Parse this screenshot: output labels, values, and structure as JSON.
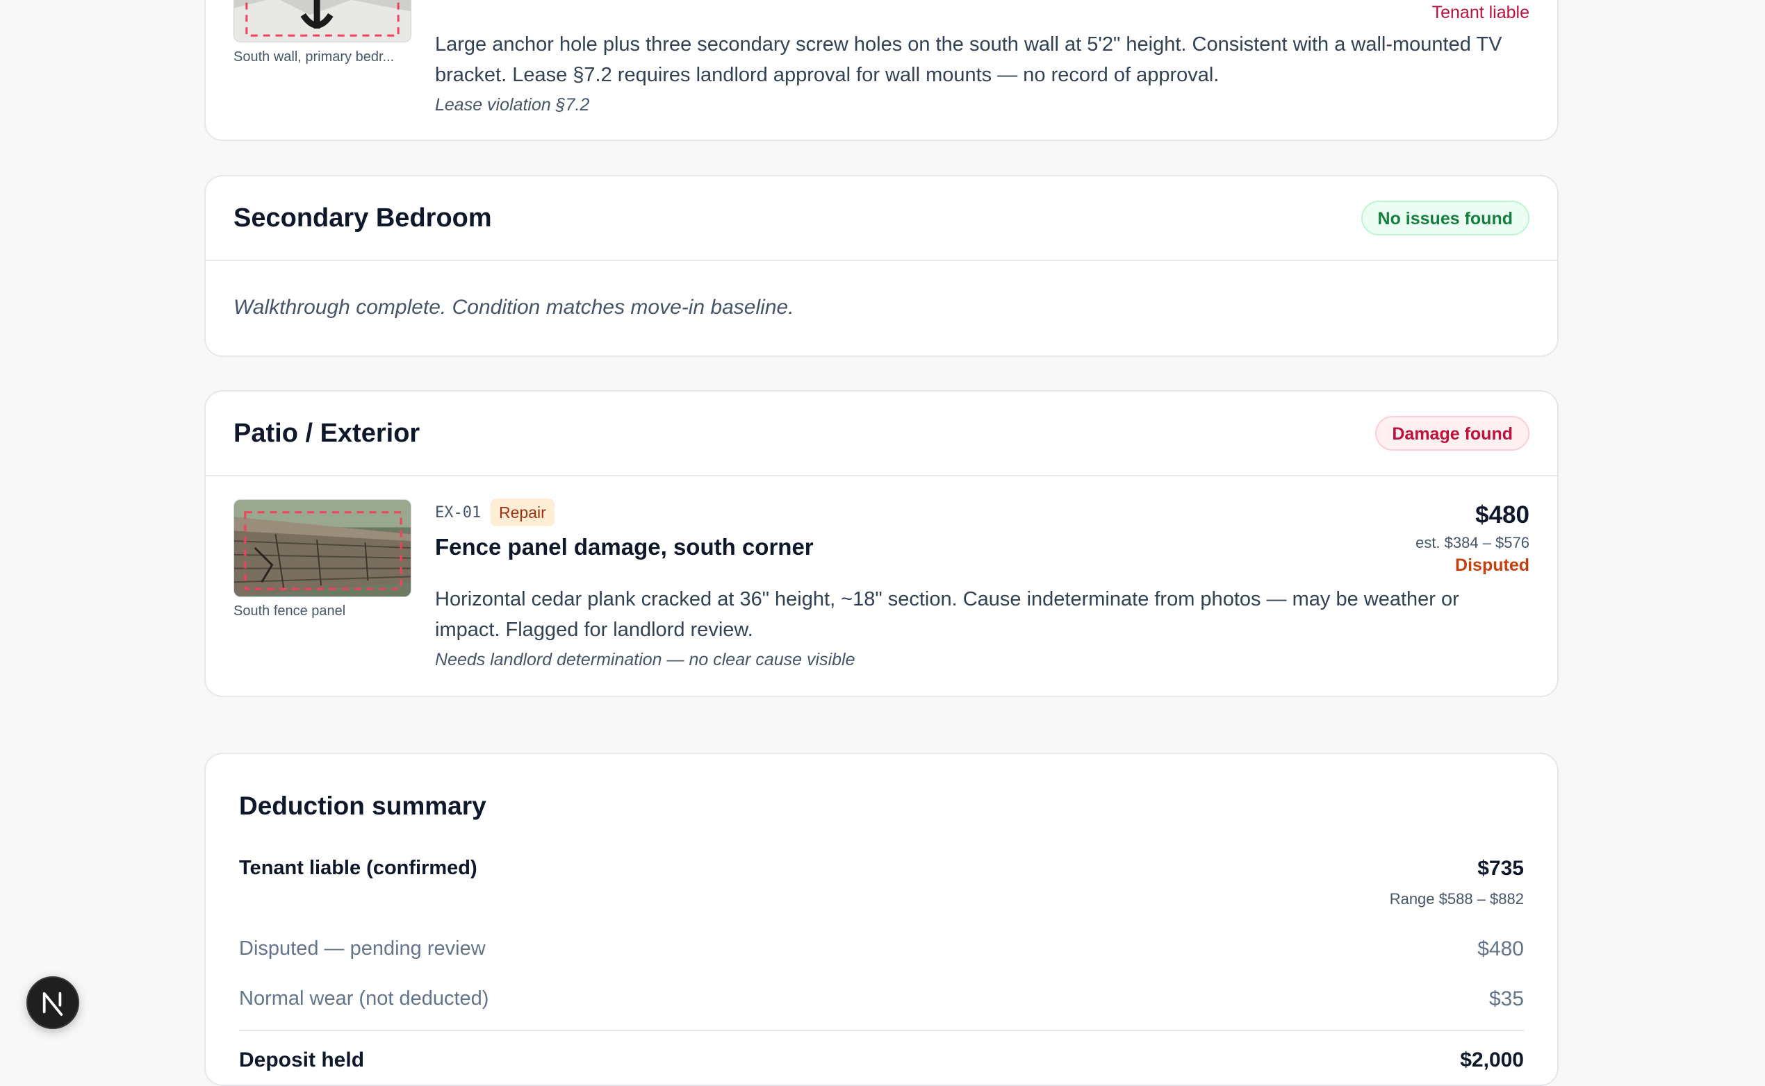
{
  "item_prev": {
    "liability": "Tenant liable",
    "description": "Large anchor hole plus three secondary screw holes on the south wall at 5'2\" height. Consistent with a wall-mounted TV bracket. Lease §7.2 requires landlord approval for wall mounts — no record of approval.",
    "note": "Lease violation §7.2",
    "photo_caption": "South wall, primary bedr..."
  },
  "room_secondary": {
    "title": "Secondary Bedroom",
    "status": "No issues found",
    "message": "Walkthrough complete. Condition matches move-in baseline."
  },
  "room_patio": {
    "title": "Patio / Exterior",
    "status": "Damage found",
    "items": [
      {
        "code": "EX-01",
        "tag": "Repair",
        "title": "Fence panel damage, south corner",
        "amount": "$480",
        "estimate": "est. $384 – $576",
        "liability": "Disputed",
        "description": "Horizontal cedar plank cracked at 36\" height, ~18\" section. Cause indeterminate from photos — may be weather or impact. Flagged for landlord review.",
        "note": "Needs landlord determination — no clear cause visible",
        "photo_caption": "South fence panel"
      }
    ]
  },
  "summary": {
    "title": "Deduction summary",
    "rows": [
      {
        "label": "Tenant liable (confirmed)",
        "amount": "$735",
        "sub": "Range $588 – $882"
      },
      {
        "label": "Disputed — pending review",
        "amount": "$480"
      },
      {
        "label": "Normal wear (not deducted)",
        "amount": "$35"
      }
    ],
    "partial_label": "Deposit held",
    "partial_amount": "$2,000"
  },
  "colors": {
    "tenant_liable": "#be123c",
    "disputed": "#c2410c",
    "ok_green": "#15803d"
  },
  "floating": {
    "logo_letter": "N",
    "icon": "nextjs-logo-icon"
  }
}
